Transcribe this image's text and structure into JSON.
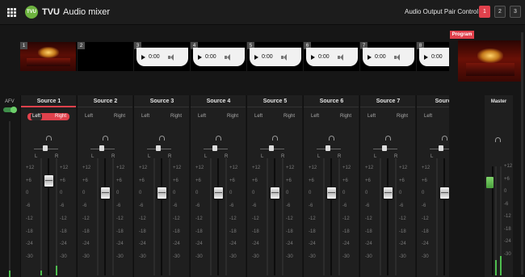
{
  "header": {
    "logo_text": "TVU",
    "title_brand": "TVU",
    "title_rest": "Audio mixer",
    "pair_label": "Audio Output Pair Control",
    "pair_buttons": [
      {
        "label": "1",
        "active": true
      },
      {
        "label": "2",
        "active": false
      },
      {
        "label": "3",
        "active": false
      }
    ]
  },
  "preview": {
    "sources": [
      {
        "num": "1",
        "kind": "stage"
      },
      {
        "num": "2",
        "kind": "black"
      },
      {
        "num": "3",
        "kind": "player",
        "time": "0:00"
      },
      {
        "num": "4",
        "kind": "player",
        "time": "0:00"
      },
      {
        "num": "5",
        "kind": "player",
        "time": "0:00"
      },
      {
        "num": "6",
        "kind": "player",
        "time": "0:00"
      },
      {
        "num": "7",
        "kind": "player",
        "time": "0:00"
      },
      {
        "num": "8",
        "kind": "player",
        "time": "0:00"
      }
    ]
  },
  "program": {
    "label": "Program"
  },
  "afv": {
    "label": "AFV",
    "on": true
  },
  "strips": [
    {
      "title": "Source 1",
      "active": true,
      "left": "Left",
      "right": "Right",
      "pan_l": "L",
      "pan_r": "R",
      "fader_db": 6,
      "meter_left": 0.04,
      "meter_right": 0.08
    },
    {
      "title": "Source 2",
      "active": false,
      "left": "Left",
      "right": "Right",
      "pan_l": "L",
      "pan_r": "R",
      "fader_db": 0,
      "meter_left": 0,
      "meter_right": 0
    },
    {
      "title": "Source 3",
      "active": false,
      "left": "Left",
      "right": "Right",
      "pan_l": "L",
      "pan_r": "R",
      "fader_db": 0,
      "meter_left": 0,
      "meter_right": 0
    },
    {
      "title": "Source 4",
      "active": false,
      "left": "Left",
      "right": "Right",
      "pan_l": "L",
      "pan_r": "R",
      "fader_db": 0,
      "meter_left": 0,
      "meter_right": 0
    },
    {
      "title": "Source 5",
      "active": false,
      "left": "Left",
      "right": "Right",
      "pan_l": "L",
      "pan_r": "R",
      "fader_db": 0,
      "meter_left": 0,
      "meter_right": 0
    },
    {
      "title": "Source 6",
      "active": false,
      "left": "Left",
      "right": "Right",
      "pan_l": "L",
      "pan_r": "R",
      "fader_db": 0,
      "meter_left": 0,
      "meter_right": 0
    },
    {
      "title": "Source 7",
      "active": false,
      "left": "Left",
      "right": "Right",
      "pan_l": "L",
      "pan_r": "R",
      "fader_db": 0,
      "meter_left": 0,
      "meter_right": 0
    },
    {
      "title": "Source",
      "active": false,
      "left": "Left",
      "right": "Right",
      "pan_l": "L",
      "pan_r": "R",
      "fader_db": 0,
      "meter_left": 0,
      "meter_right": 0
    }
  ],
  "scale": [
    "+12",
    "+6",
    "0",
    "-6",
    "-12",
    "-18",
    "-24",
    "-30"
  ],
  "master": {
    "title": "Master",
    "fader_db": 3,
    "meter_left": 0.14,
    "meter_right": 0.18
  },
  "colors": {
    "accent": "#e0414c",
    "meter": "#4fbf4f",
    "background": "#161616",
    "strip": "#1f1f1f"
  }
}
